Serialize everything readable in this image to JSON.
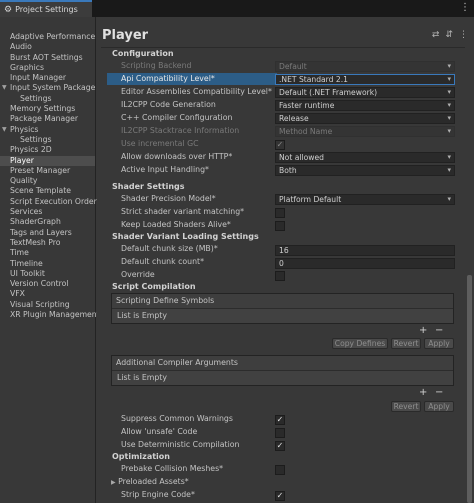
{
  "window": {
    "tab_title": "Project Settings"
  },
  "sidebar": {
    "items": [
      {
        "label": "Adaptive Performance"
      },
      {
        "label": "Audio"
      },
      {
        "label": "Burst AOT Settings"
      },
      {
        "label": "Graphics"
      },
      {
        "label": "Input Manager"
      },
      {
        "label": "Input System Package"
      },
      {
        "label": "Settings"
      },
      {
        "label": "Memory Settings"
      },
      {
        "label": "Package Manager"
      },
      {
        "label": "Physics"
      },
      {
        "label": "Settings"
      },
      {
        "label": "Physics 2D"
      },
      {
        "label": "Player"
      },
      {
        "label": "Preset Manager"
      },
      {
        "label": "Quality"
      },
      {
        "label": "Scene Template"
      },
      {
        "label": "Script Execution Order"
      },
      {
        "label": "Services"
      },
      {
        "label": "ShaderGraph"
      },
      {
        "label": "Tags and Layers"
      },
      {
        "label": "TextMesh Pro"
      },
      {
        "label": "Time"
      },
      {
        "label": "Timeline"
      },
      {
        "label": "UI Toolkit"
      },
      {
        "label": "Version Control"
      },
      {
        "label": "VFX"
      },
      {
        "label": "Visual Scripting"
      },
      {
        "label": "XR Plugin Management"
      }
    ]
  },
  "header": {
    "title": "Player",
    "help_icon": "help-icon",
    "preset_icon": "preset-icon",
    "menu_icon": "menu-icon"
  },
  "configuration": {
    "title": "Configuration",
    "scripting_backend": {
      "label": "Scripting Backend",
      "value": "Default"
    },
    "api_compat": {
      "label": "Api Compatibility Level*",
      "value": ".NET Standard 2.1"
    },
    "editor_compat": {
      "label": "Editor Assemblies Compatibility Level*",
      "value": "Default (.NET Framework)"
    },
    "il2cpp_gen": {
      "label": "IL2CPP Code Generation",
      "value": "Faster runtime"
    },
    "cpp_config": {
      "label": "C++ Compiler Configuration",
      "value": "Release"
    },
    "il2cpp_stack": {
      "label": "IL2CPP Stacktrace Information",
      "value": "Method Name"
    },
    "incremental_gc": {
      "label": "Use incremental GC"
    },
    "http": {
      "label": "Allow downloads over HTTP*",
      "value": "Not allowed"
    },
    "input": {
      "label": "Active Input Handling*",
      "value": "Both"
    }
  },
  "shader_settings": {
    "title": "Shader Settings",
    "precision": {
      "label": "Shader Precision Model*",
      "value": "Platform Default"
    },
    "strict": {
      "label": "Strict shader variant matching*"
    },
    "keep_alive": {
      "label": "Keep Loaded Shaders Alive*"
    }
  },
  "shader_variant": {
    "title": "Shader Variant Loading Settings",
    "chunk_size": {
      "label": "Default chunk size (MB)*",
      "value": "16"
    },
    "chunk_count": {
      "label": "Default chunk count*",
      "value": "0"
    },
    "override": {
      "label": "Override"
    }
  },
  "script_compilation": {
    "title": "Script Compilation",
    "define_symbols": {
      "header": "Scripting Define Symbols",
      "empty": "List is Empty"
    },
    "copy_defines": "Copy Defines",
    "revert": "Revert",
    "apply": "Apply",
    "compiler_args": {
      "header": "Additional Compiler Arguments",
      "empty": "List is Empty"
    },
    "revert2": "Revert",
    "apply2": "Apply",
    "plus": "+",
    "minus": "−",
    "suppress": {
      "label": "Suppress Common Warnings"
    },
    "unsafe": {
      "label": "Allow 'unsafe' Code"
    },
    "deterministic": {
      "label": "Use Deterministic Compilation"
    }
  },
  "optimization": {
    "title": "Optimization",
    "prebake": {
      "label": "Prebake Collision Meshes*"
    },
    "preloaded": {
      "label": "Preloaded Assets*"
    },
    "strip": {
      "label": "Strip Engine Code*"
    }
  },
  "check_glyph": "✓"
}
